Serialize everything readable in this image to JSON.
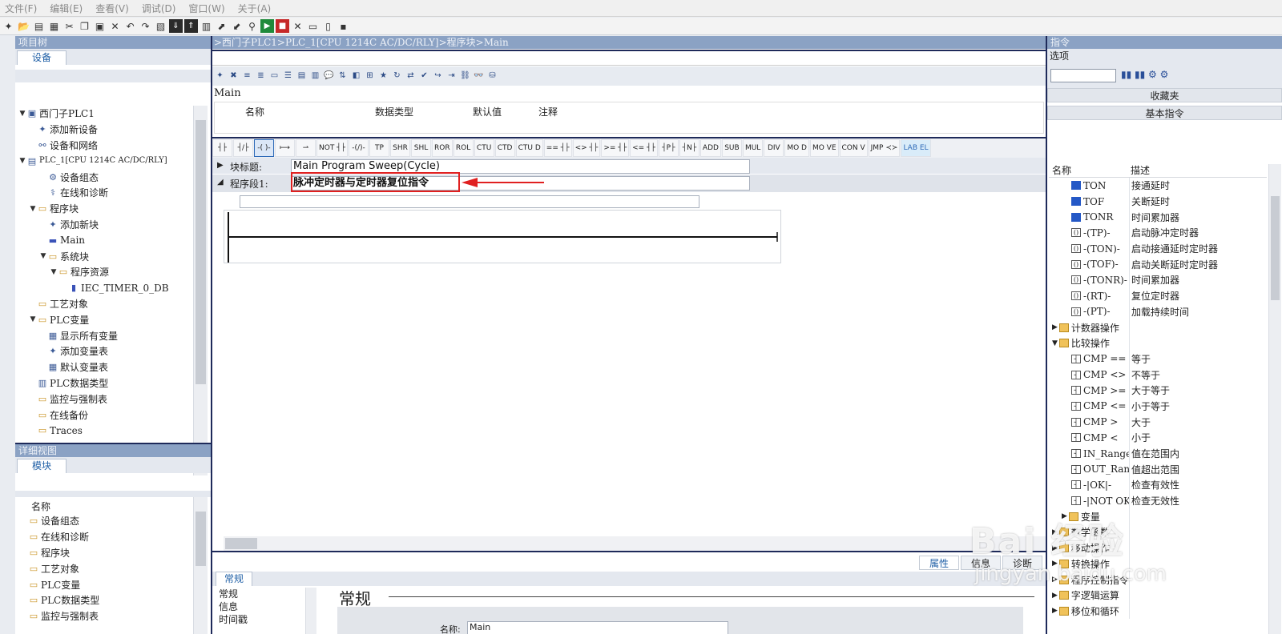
{
  "menu": [
    "文件(F)",
    "编辑(E)",
    "查看(V)",
    "调试(D)",
    "窗口(W)",
    "关于(A)"
  ],
  "project_tree": {
    "title": "项目树",
    "tab": "设备",
    "nodes": [
      {
        "label": "西门子PLC1",
        "level": 0,
        "arrow": "▼",
        "icon": "plc-icon"
      },
      {
        "label": "添加新设备",
        "level": 1,
        "arrow": "",
        "icon": "add-device-icon"
      },
      {
        "label": "设备和网络",
        "level": 1,
        "arrow": "",
        "icon": "network-icon"
      },
      {
        "label": "PLC_1[CPU 1214C AC/DC/RLY]",
        "level": 0,
        "arrow": "▼",
        "icon": "cpu-icon"
      },
      {
        "label": "设备组态",
        "level": 2,
        "arrow": "",
        "icon": "device-config-icon"
      },
      {
        "label": "在线和诊断",
        "level": 2,
        "arrow": "",
        "icon": "diagnostic-icon"
      },
      {
        "label": "程序块",
        "level": 1,
        "arrow": "▼",
        "icon": "folder-icon"
      },
      {
        "label": "添加新块",
        "level": 2,
        "arrow": "",
        "icon": "add-block-icon"
      },
      {
        "label": "Main",
        "level": 2,
        "arrow": "",
        "icon": "ob-icon"
      },
      {
        "label": "系统块",
        "level": 2,
        "arrow": "▼",
        "icon": "folder-icon"
      },
      {
        "label": "程序资源",
        "level": 3,
        "arrow": "▼",
        "icon": "folder-icon"
      },
      {
        "label": "IEC_TIMER_0_DB",
        "level": 4,
        "arrow": "",
        "icon": "db-icon"
      },
      {
        "label": "工艺对象",
        "level": 1,
        "arrow": "",
        "icon": "folder-icon"
      },
      {
        "label": "PLC变量",
        "level": 1,
        "arrow": "▼",
        "icon": "folder-icon"
      },
      {
        "label": "显示所有变量",
        "level": 2,
        "arrow": "",
        "icon": "tag-icon"
      },
      {
        "label": "添加变量表",
        "level": 2,
        "arrow": "",
        "icon": "add-tag-icon"
      },
      {
        "label": "默认变量表",
        "level": 2,
        "arrow": "",
        "icon": "tag-table-icon"
      },
      {
        "label": "PLC数据类型",
        "level": 1,
        "arrow": "",
        "icon": "datatype-icon"
      },
      {
        "label": "监控与强制表",
        "level": 1,
        "arrow": "",
        "icon": "folder-icon"
      },
      {
        "label": "在线备份",
        "level": 1,
        "arrow": "",
        "icon": "folder-icon"
      },
      {
        "label": "Traces",
        "level": 1,
        "arrow": "",
        "icon": "folder-icon"
      }
    ]
  },
  "detail_view": {
    "title": "详细视图",
    "tab": "模块",
    "header": "名称",
    "items": [
      "设备组态",
      "在线和诊断",
      "程序块",
      "工艺对象",
      "PLC变量",
      "PLC数据类型",
      "监控与强制表"
    ]
  },
  "editor": {
    "breadcrumb": ">西门子PLC1>PLC_1[CPU 1214C AC/DC/RLY]>程序块>Main",
    "block_name": "Main",
    "interface_columns": [
      "名称",
      "数据类型",
      "默认值",
      "注释"
    ],
    "lad_buttons": [
      "┤├",
      "┤/├",
      "-( )-",
      "⟼",
      "⇀",
      "NOT ┤├",
      "-(/)-",
      "TP",
      "SHR",
      "SHL",
      "ROR",
      "ROL",
      "CTU",
      "CTD",
      "CTU D",
      "== ┤├",
      "<> ┤├",
      ">= ┤├",
      "<= ┤├",
      "┤P├",
      "┤N├",
      "ADD",
      "SUB",
      "MUL",
      "DIV",
      "MO D",
      "MO VE",
      "CON V",
      "JMP ≺≻",
      "LAB EL"
    ],
    "block_title_label": "块标题:",
    "block_title_value": "Main Program Sweep(Cycle)",
    "network_label": "程序段1:",
    "network_value": "脉冲定时器与定时器复位指令"
  },
  "properties": {
    "tabs": [
      "属性",
      "信息",
      "诊断"
    ],
    "subtab": "常规",
    "nav": [
      "常规",
      "信息",
      "时间戳"
    ],
    "heading": "常规",
    "name_label": "名称:",
    "name_value": "Main"
  },
  "instructions": {
    "title": "指令",
    "options_label": "选项",
    "favorites": "收藏夹",
    "basic": "基本指令",
    "col_name": "名称",
    "col_desc": "描述",
    "rows": [
      {
        "name": "TON",
        "desc": "接通延时",
        "icon": "blue",
        "indent": 2
      },
      {
        "name": "TOF",
        "desc": "关断延时",
        "icon": "blue",
        "indent": 2
      },
      {
        "name": "TONR",
        "desc": "时间累加器",
        "icon": "blue",
        "indent": 2
      },
      {
        "name": "-(TP)-",
        "desc": "启动脉冲定时器",
        "icon": "coil",
        "indent": 2
      },
      {
        "name": "-(TON)-",
        "desc": "启动接通延时定时器",
        "icon": "coil",
        "indent": 2
      },
      {
        "name": "-(TOF)-",
        "desc": "启动关断延时定时器",
        "icon": "coil",
        "indent": 2
      },
      {
        "name": "-(TONR)-",
        "desc": "时间累加器",
        "icon": "coil",
        "indent": 2
      },
      {
        "name": "-(RT)-",
        "desc": "复位定时器",
        "icon": "coil",
        "indent": 2
      },
      {
        "name": "-(PT)-",
        "desc": "加载持续时间",
        "icon": "coil",
        "indent": 2
      },
      {
        "name": "计数器操作",
        "desc": "",
        "icon": "fold",
        "indent": 0,
        "arrow": "▶"
      },
      {
        "name": "比较操作",
        "desc": "",
        "icon": "fold",
        "indent": 0,
        "arrow": "▼"
      },
      {
        "name": "CMP ==",
        "desc": "等于",
        "icon": "box",
        "indent": 2
      },
      {
        "name": "CMP <>",
        "desc": "不等于",
        "icon": "box",
        "indent": 2
      },
      {
        "name": "CMP >=",
        "desc": "大于等于",
        "icon": "box",
        "indent": 2
      },
      {
        "name": "CMP <=",
        "desc": "小于等于",
        "icon": "box",
        "indent": 2
      },
      {
        "name": "CMP >",
        "desc": "大于",
        "icon": "box",
        "indent": 2
      },
      {
        "name": "CMP <",
        "desc": "小于",
        "icon": "box",
        "indent": 2
      },
      {
        "name": "IN_Range",
        "desc": "值在范围内",
        "icon": "box",
        "indent": 2
      },
      {
        "name": "OUT_Range",
        "desc": "值超出范围",
        "icon": "box",
        "indent": 2
      },
      {
        "name": "-|OK|-",
        "desc": "检查有效性",
        "icon": "box",
        "indent": 2
      },
      {
        "name": "-|NOT OK|-",
        "desc": "检查无效性",
        "icon": "box",
        "indent": 2
      },
      {
        "name": "变量",
        "desc": "",
        "icon": "fold",
        "indent": 1,
        "arrow": "▶"
      },
      {
        "name": "数学函数",
        "desc": "",
        "icon": "fold",
        "indent": 0,
        "arrow": "▶"
      },
      {
        "name": "移动操作",
        "desc": "",
        "icon": "fold",
        "indent": 0,
        "arrow": "▶"
      },
      {
        "name": "转换操作",
        "desc": "",
        "icon": "fold",
        "indent": 0,
        "arrow": "▶"
      },
      {
        "name": "程序控制指令",
        "desc": "",
        "icon": "fold",
        "indent": 0,
        "arrow": "▶"
      },
      {
        "name": "字逻辑运算",
        "desc": "",
        "icon": "fold",
        "indent": 0,
        "arrow": "▶"
      },
      {
        "name": "移位和循环",
        "desc": "",
        "icon": "fold",
        "indent": 0,
        "arrow": "▶"
      }
    ]
  },
  "watermark": {
    "line1": "Bai 经验",
    "line2": "jingyan.baidu.com"
  },
  "colors": {
    "panel_title": "#8ba2c4",
    "frame": "#1e2a5a",
    "highlight": "#e02020",
    "link_blue": "#1f5fa6"
  }
}
